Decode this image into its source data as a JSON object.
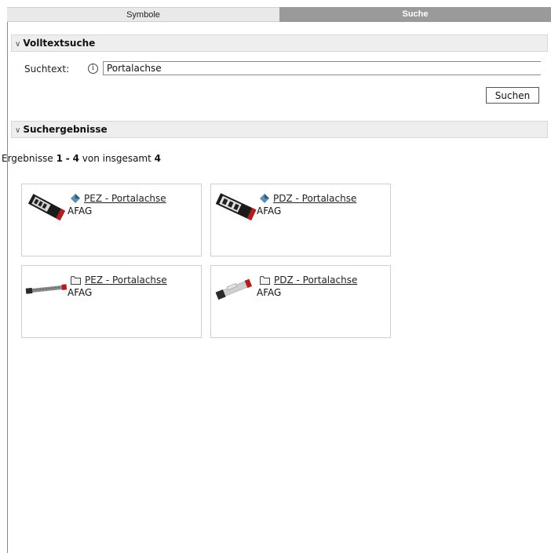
{
  "tabs": [
    {
      "label": "Symbole",
      "active": false
    },
    {
      "label": "Suche",
      "active": true
    }
  ],
  "fulltext_section": {
    "title": "Volltextsuche",
    "collapse_icon": "double-chevron-down-icon"
  },
  "search": {
    "label": "Suchtext:",
    "info_icon": "info-circle-icon",
    "info_glyph": "i",
    "value": "Portalachse",
    "button_label": "Suchen"
  },
  "results_section": {
    "title": "Suchergebnisse",
    "collapse_icon": "double-chevron-down-icon"
  },
  "results_summary": {
    "prefix": "Ergebnisse",
    "from": "1",
    "separator": "-",
    "to": "4",
    "middle": "von insgesamt",
    "total": "4"
  },
  "results": [
    {
      "title": "PEZ - Portalachse",
      "vendor": "AFAG",
      "type_icon": "part-diamond-icon",
      "thumbnail": "black-actuator-block"
    },
    {
      "title": "PDZ - Portalachse",
      "vendor": "AFAG",
      "type_icon": "part-diamond-icon",
      "thumbnail": "black-actuator-block"
    },
    {
      "title": "PEZ - Portalachse",
      "vendor": "AFAG",
      "type_icon": "folder-icon",
      "thumbnail": "long-linear-axis"
    },
    {
      "title": "PDZ - Portalachse",
      "vendor": "AFAG",
      "type_icon": "folder-icon",
      "thumbnail": "white-linear-axis"
    }
  ],
  "colors": {
    "active_tab_bg": "#9a9a9a",
    "inactive_tab_bg": "#e9e9e9",
    "section_header_bg": "#eeeeee",
    "card_border": "#cfcfcf",
    "diamond_icon": "#5b8fb0"
  }
}
